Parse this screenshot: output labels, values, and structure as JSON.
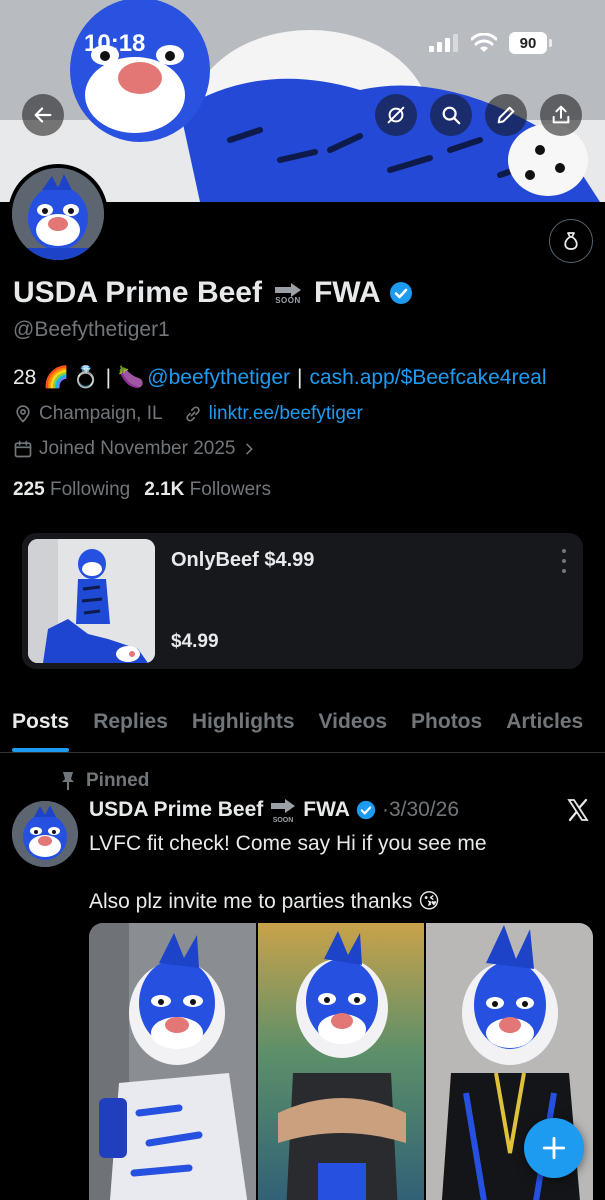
{
  "status_bar": {
    "time": "10:18",
    "battery": "90"
  },
  "profile": {
    "display_name": "USDA Prime Beef",
    "name_suffix": "FWA",
    "soon_label": "SOON",
    "handle": "@Beefythetiger1",
    "bio": {
      "prefix": "28",
      "separator1": "|",
      "mention": "@beefythetiger",
      "separator2": "|",
      "link": "cash.app/$Beefcake4real"
    },
    "location": "Champaign, IL",
    "website": "linktr.ee/beefytiger",
    "joined": "Joined November 2025",
    "following_count": "225",
    "following_label": "Following",
    "followers_count": "2.1K",
    "followers_label": "Followers"
  },
  "product": {
    "title": "OnlyBeef  $4.99",
    "price": "$4.99"
  },
  "tabs": [
    {
      "label": "Posts",
      "active": true
    },
    {
      "label": "Replies"
    },
    {
      "label": "Highlights"
    },
    {
      "label": "Videos"
    },
    {
      "label": "Photos"
    },
    {
      "label": "Articles"
    }
  ],
  "post": {
    "pinned_label": "Pinned",
    "author_name": "USDA Prime Beef",
    "author_suffix": "FWA",
    "date": "3/30/26",
    "text": "LVFC fit check! Come say Hi if you see me\n\nAlso plz invite me to parties thanks 😘"
  },
  "colors": {
    "accent": "#1d9bf0",
    "background": "#000000",
    "secondary_text": "#71767b",
    "fursuit_blue": "#1f4fd8"
  }
}
